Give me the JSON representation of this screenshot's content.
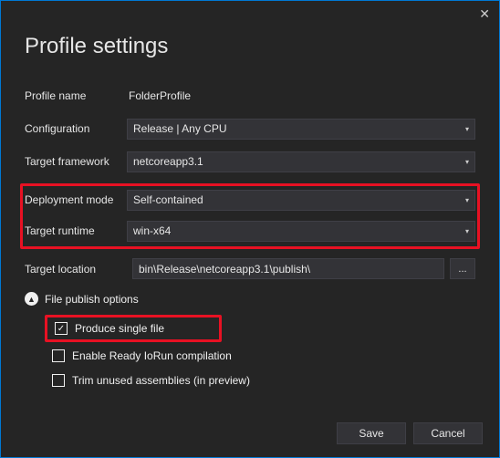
{
  "title": "Profile settings",
  "fields": {
    "profile_name_label": "Profile name",
    "profile_name_value": "FolderProfile",
    "configuration_label": "Configuration",
    "configuration_value": "Release | Any CPU",
    "target_framework_label": "Target framework",
    "target_framework_value": "netcoreapp3.1",
    "deployment_mode_label": "Deployment mode",
    "deployment_mode_value": "Self-contained",
    "target_runtime_label": "Target runtime",
    "target_runtime_value": "win-x64",
    "target_location_label": "Target location",
    "target_location_value": "bin\\Release\\netcoreapp3.1\\publish\\",
    "browse_label": "..."
  },
  "file_publish": {
    "section_label": "File publish options",
    "single_file_label": "Produce single file",
    "ready_to_run_label": "Enable Ready IoRun compilation",
    "trim_label": "Trim unused assemblies (in preview)"
  },
  "buttons": {
    "save": "Save",
    "cancel": "Cancel"
  }
}
